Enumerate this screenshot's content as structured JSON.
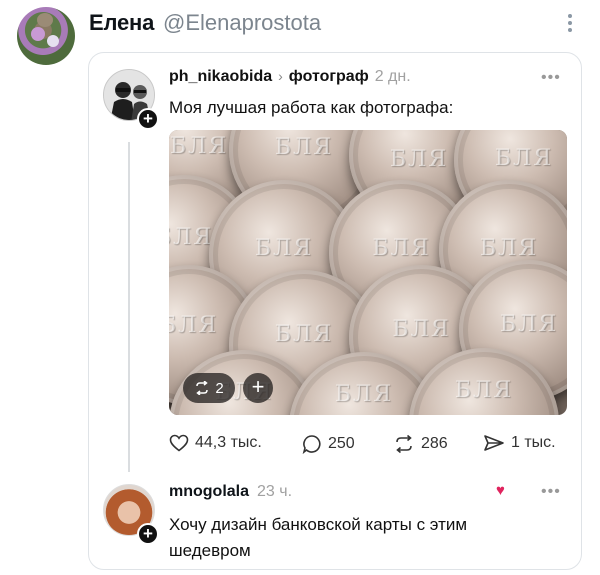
{
  "outer": {
    "name": "Елена",
    "handle": "@Elenaprostota"
  },
  "post": {
    "username": "ph_nikaobida",
    "topic": "фотограф",
    "time": "2 дн.",
    "text": "Моя лучшая работа как фотографа:",
    "photo": {
      "coin_word": "БЛЯ",
      "repost_count": "2",
      "plus_label": "+"
    },
    "actions": {
      "likes": "44,3 тыс.",
      "comments": "250",
      "reposts": "286",
      "shares": "1 тыс."
    }
  },
  "reply": {
    "username": "mnogolala",
    "time": "23 ч.",
    "text": "Хочу дизайн банковской карты с этим шедевром"
  },
  "icons": {
    "more": "more-icon",
    "heart": "heart-icon",
    "comment": "comment-icon",
    "repost": "repost-icon",
    "share": "share-icon"
  },
  "colors": {
    "text": "#0f1419",
    "muted": "#a1a1a1",
    "heart": "#e0245e"
  }
}
